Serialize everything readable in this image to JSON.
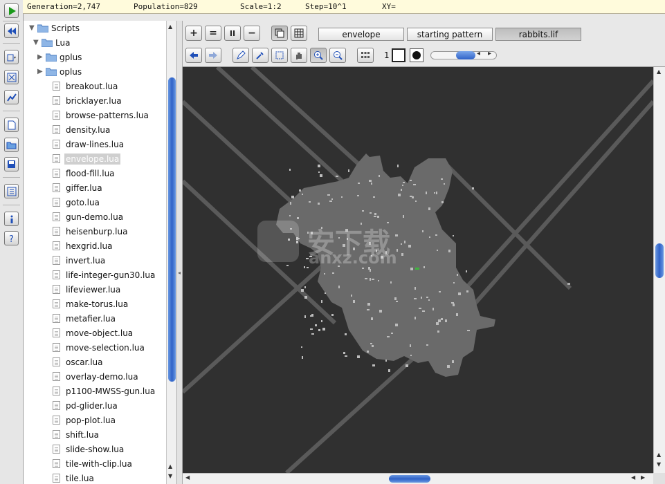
{
  "status": {
    "generation": "Generation=2,747",
    "population": "Population=829",
    "scale": "Scale=1:2",
    "step": "Step=10^1",
    "xy": "XY="
  },
  "left_toolbar": {
    "icons": [
      "play-icon",
      "rewind-icon",
      "layer-icon",
      "fit-icon",
      "timeline-icon",
      "new-file-icon",
      "open-folder-icon",
      "save-icon",
      "pattern-list-icon",
      "info-icon",
      "help-icon"
    ]
  },
  "sidebar": {
    "root": "Scripts",
    "lua_folder": "Lua",
    "subfolders": [
      "gplus",
      "oplus"
    ],
    "files": [
      "breakout.lua",
      "bricklayer.lua",
      "browse-patterns.lua",
      "density.lua",
      "draw-lines.lua",
      "envelope.lua",
      "flood-fill.lua",
      "giffer.lua",
      "goto.lua",
      "gun-demo.lua",
      "heisenburp.lua",
      "hexgrid.lua",
      "invert.lua",
      "life-integer-gun30.lua",
      "lifeviewer.lua",
      "make-torus.lua",
      "metafier.lua",
      "move-object.lua",
      "move-selection.lua",
      "oscar.lua",
      "overlay-demo.lua",
      "p1100-MWSS-gun.lua",
      "pd-glider.lua",
      "pop-plot.lua",
      "shift.lua",
      "slide-show.lua",
      "tile-with-clip.lua",
      "tile.lua"
    ],
    "selected_file": "envelope.lua"
  },
  "toolbar": {
    "row1_buttons": [
      "+",
      "=",
      "II",
      "−"
    ],
    "tabs": [
      "envelope",
      "starting pattern",
      "rabbits.lif"
    ],
    "active_tab": "rabbits.lif",
    "state_number": "1"
  },
  "watermark": {
    "text1": "安下载",
    "text2": "anxz.com"
  },
  "colors": {
    "status_bg": "#fffbdc",
    "canvas_bg": "#303030",
    "cell_gray": "#6e6e6e",
    "scroll_blue": "#3a6fd0"
  }
}
